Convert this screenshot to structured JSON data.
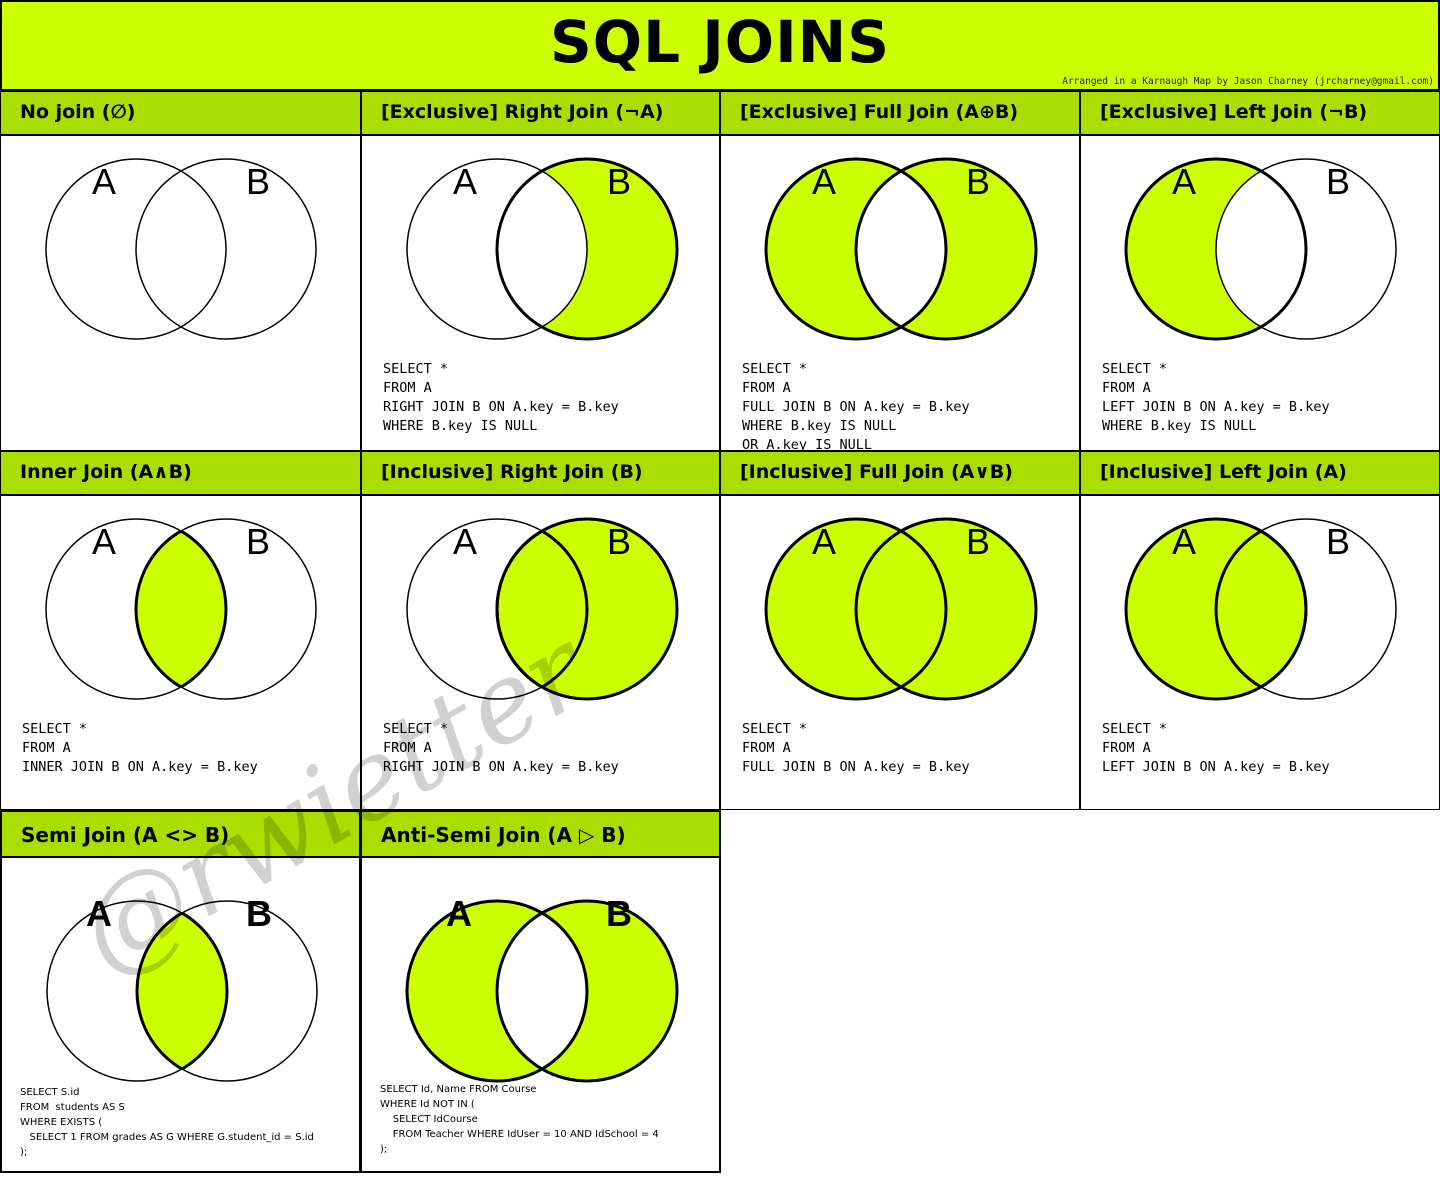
{
  "title": "SQL JOINS",
  "credit": "Arranged in a Karnaugh Map by Jason Charney (jrcharney@gmail.com)",
  "colors": {
    "accent": "#ccff00",
    "header": "#aadd00",
    "stroke": "#000000"
  },
  "cells": [
    {
      "header": "No join (∅)",
      "a": "A",
      "b": "B",
      "fill": "none",
      "sql": ""
    },
    {
      "header": "[Exclusive] Right Join (¬A)",
      "a": "A",
      "b": "B",
      "fill": "b-only",
      "sql": "SELECT *\nFROM A\nRIGHT JOIN B ON A.key = B.key\nWHERE B.key IS NULL"
    },
    {
      "header": "[Exclusive] Full Join (A⊕B)",
      "a": "A",
      "b": "B",
      "fill": "xor",
      "sql": "SELECT *\nFROM A\nFULL JOIN B ON A.key = B.key\nWHERE B.key IS NULL\nOR A.key IS NULL"
    },
    {
      "header": "[Exclusive] Left Join (¬B)",
      "a": "A",
      "b": "B",
      "fill": "a-only",
      "sql": "SELECT *\nFROM A\nLEFT JOIN B ON A.key = B.key\nWHERE B.key IS NULL"
    },
    {
      "header": "Inner Join (A∧B)",
      "a": "A",
      "b": "B",
      "fill": "inner",
      "sql": "SELECT *\nFROM A\nINNER JOIN B ON A.key = B.key"
    },
    {
      "header": "[Inclusive] Right Join (B)",
      "a": "A",
      "b": "B",
      "fill": "b-all",
      "sql": "SELECT *\nFROM A\nRIGHT JOIN B ON A.key = B.key"
    },
    {
      "header": "[Inclusive] Full Join (A∨B)",
      "a": "A",
      "b": "B",
      "fill": "all",
      "sql": "SELECT *\nFROM A\nFULL JOIN B ON A.key = B.key"
    },
    {
      "header": "[Inclusive] Left Join (A)",
      "a": "A",
      "b": "B",
      "fill": "a-all",
      "sql": "SELECT *\nFROM A\nLEFT JOIN B ON A.key = B.key"
    },
    {
      "header": "Semi Join (A <> B)",
      "a": "A",
      "b": "B",
      "fill": "inner",
      "sql": "SELECT S.id\nFROM  students AS S\nWHERE EXISTS (\n   SELECT 1 FROM grades AS G WHERE G.student_id = S.id\n);"
    },
    {
      "header": "Anti-Semi Join (A ▷ B)",
      "a": "A",
      "b": "B",
      "fill": "xor",
      "sql": "SELECT Id, Name FROM Course\nWHERE Id NOT IN (\n    SELECT IdCourse\n    FROM Teacher WHERE IdUser = 10 AND IdSchool = 4\n);"
    }
  ],
  "watermark": "@rwietter"
}
